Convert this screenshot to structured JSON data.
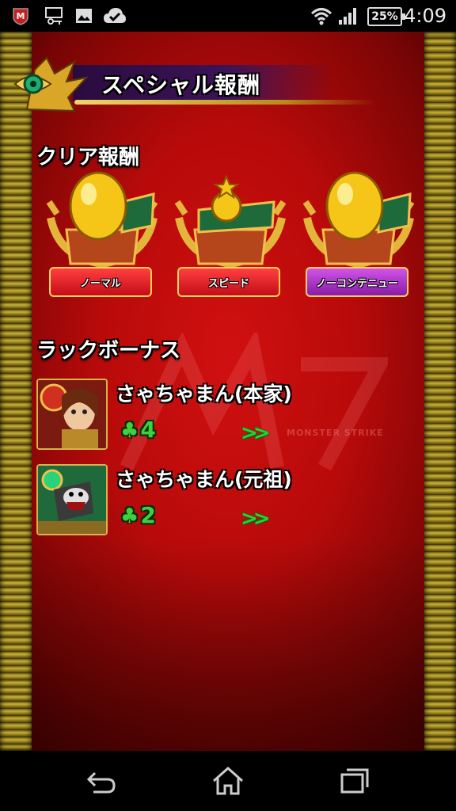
{
  "status_bar": {
    "time": "4:09",
    "battery": "25%",
    "icons_left": [
      "mcafee-icon",
      "usb-debug-icon",
      "key-icon",
      "image-icon",
      "cloud-check-icon"
    ],
    "icons_right": [
      "wifi-icon",
      "signal-icon",
      "battery-icon"
    ]
  },
  "header": {
    "title": "スペシャル報酬"
  },
  "clear_reward": {
    "title": "クリア報酬",
    "items": [
      {
        "label": "ノーマル",
        "reward": "egg",
        "ribbon_color": "#d01020"
      },
      {
        "label": "スピード",
        "reward": "coin",
        "ribbon_color": "#d01020"
      },
      {
        "label": "ノーコンテニュー",
        "reward": "egg",
        "ribbon_color": "#a020c0"
      }
    ]
  },
  "luck_bonus": {
    "title": "ラックボーナス",
    "items": [
      {
        "name": "さゃちゃまん(本家)",
        "luck": "4",
        "arrow": ">>"
      },
      {
        "name": "さゃちゃまん(元祖)",
        "luck": "2",
        "arrow": ">>"
      }
    ]
  },
  "watermark": "MONSTER STRIKE",
  "nav_bar": {
    "buttons": [
      "back-icon",
      "home-icon",
      "recent-apps-icon"
    ]
  }
}
